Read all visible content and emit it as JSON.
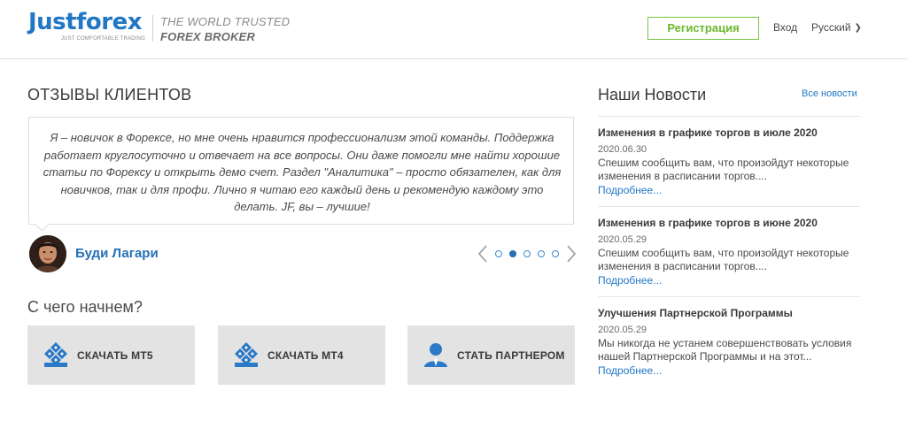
{
  "header": {
    "logo_name": "Justforex",
    "logo_tagline": "JUST COMFORTABLE TRADING",
    "slogan_line1": "THE WORLD TRUSTED",
    "slogan_line2": "FOREX BROKER",
    "register_label": "Регистрация",
    "login_label": "Вход",
    "language_label": "Русский",
    "accent_green": "#7cc242",
    "brand_blue": "#2177c4"
  },
  "reviews": {
    "title": "ОТЗЫВЫ КЛИЕНТОВ",
    "quote": "Я – новичок в Форексе, но мне очень нравится профессионализм этой команды. Поддержка работает круглосуточно и отвечает на все вопросы. Они даже помогли мне найти хорошие статьи по Форексу и открыть демо счет. Раздел \"Аналитика\" – просто обязателен, как для новичков, так и для профи. Лично я читаю его каждый день и рекомендую каждому это делать. JF, вы – лучшие!",
    "author": "Буди Лагари",
    "slide_count": 5,
    "active_slide": 2
  },
  "start": {
    "title": "С чего начнем?",
    "tiles": [
      {
        "label": "СКАЧАТЬ MT5",
        "icon": "mt5-download-icon"
      },
      {
        "label": "СКАЧАТЬ MT4",
        "icon": "mt4-download-icon"
      },
      {
        "label": "СТАТЬ ПАРТНЕРОМ",
        "icon": "partner-person-icon"
      }
    ]
  },
  "news": {
    "title": "Наши Новости",
    "all_link": "Все новости",
    "items": [
      {
        "title": "Изменения в графике торгов в июле 2020",
        "date": "2020.06.30",
        "text": "Спешим сообщить вам, что произойдут некоторые изменения в расписании торгов....",
        "more": "Подробнее..."
      },
      {
        "title": "Изменения в графике торгов в июне 2020",
        "date": "2020.05.29",
        "text": "Спешим сообщить вам, что произойдут некоторые изменения в расписании торгов....",
        "more": "Подробнее..."
      },
      {
        "title": "Улучшения Партнерской Программы",
        "date": "2020.05.29",
        "text": "Мы никогда не устанем совершенствовать условия нашей Партнерской Программы и на этот...",
        "more": "Подробнее..."
      }
    ]
  }
}
